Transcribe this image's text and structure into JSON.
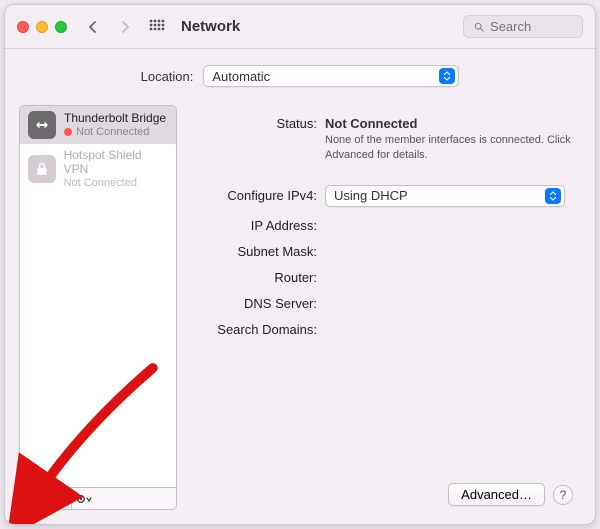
{
  "window": {
    "title": "Network"
  },
  "search": {
    "placeholder": "Search"
  },
  "location": {
    "label": "Location:",
    "value": "Automatic"
  },
  "sidebar": {
    "items": [
      {
        "name": "Thunderbolt Bridge",
        "status": "Not Connected",
        "icon": "thunderbolt-icon",
        "dot": "red",
        "selected": true
      },
      {
        "name": "Hotspot Shield VPN",
        "status": "Not Connected",
        "icon": "lock-icon"
      }
    ],
    "footer": {
      "add_tooltip": "+",
      "remove_tooltip": "−",
      "more_tooltip": "⊙"
    }
  },
  "details": {
    "status_label": "Status:",
    "status_value": "Not Connected",
    "status_hint": "None of the member interfaces is connected. Click Advanced for details.",
    "configure_label": "Configure IPv4:",
    "configure_value": "Using DHCP",
    "ip_label": "IP Address:",
    "subnet_label": "Subnet Mask:",
    "router_label": "Router:",
    "dns_label": "DNS Server:",
    "searchdomains_label": "Search Domains:",
    "advanced_label": "Advanced…",
    "help_label": "?"
  }
}
